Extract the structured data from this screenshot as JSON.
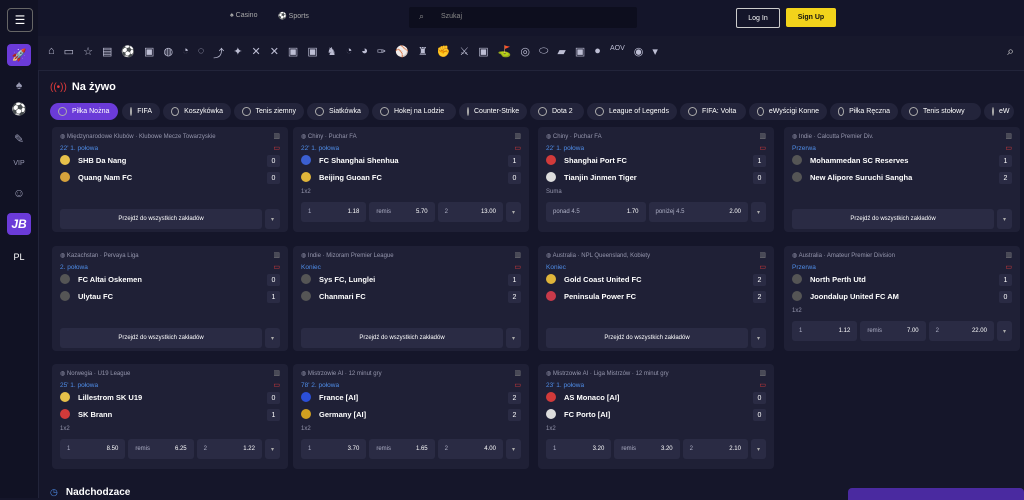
{
  "nav": {
    "casino": "Casino",
    "sports": "Sports",
    "search_placeholder": "Szukaj",
    "login": "Log In",
    "signup": "Sign Up",
    "lang": "PL",
    "jb": "JB"
  },
  "live_title": "Na żywo",
  "upcoming_title": "Nadchodzace",
  "sports": [
    "Piłka Nożna",
    "FIFA",
    "Koszykówka",
    "Tenis ziemny",
    "Siatkówka",
    "Hokej na Lodzie",
    "Counter-Strike",
    "Dota 2",
    "League of Legends",
    "FIFA: Volta",
    "eWyścigi Konne",
    "Piłka Ręczna",
    "Tenis stołowy",
    "eW"
  ],
  "all_bets": "Przejdź do wszystkich zakładów",
  "matches": [
    {
      "comp": "Międzynarodowe Klubów · Klubowe Mecze Towarzyskie",
      "status": "22' 1. połowa",
      "t1": "SHB Da Nang",
      "s1": "0",
      "t2": "Quang Nam FC",
      "s2": "0",
      "c1": "#e7c14a",
      "c2": "#d6a23c"
    },
    {
      "comp": "Chiny · Puchar FA",
      "status": "22' 1. połowa",
      "t1": "FC Shanghai Shenhua",
      "s1": "1",
      "t2": "Beijing Guoan FC",
      "s2": "0",
      "c1": "#3b5fd0",
      "c2": "#e0b53a",
      "market": "1x2",
      "odds": [
        [
          "1",
          "1.18"
        ],
        [
          "remis",
          "5.70"
        ],
        [
          "2",
          "13.00"
        ]
      ]
    },
    {
      "comp": "Chiny · Puchar FA",
      "status": "22' 1. połowa",
      "t1": "Shanghai Port FC",
      "s1": "1",
      "t2": "Tianjin Jinmen Tiger",
      "s2": "0",
      "c1": "#d23a3a",
      "c2": "#dddddd",
      "market": "Suma",
      "odds": [
        [
          "ponad 4.5",
          "1.70"
        ],
        [
          "poniżej 4.5",
          "2.00"
        ]
      ]
    },
    {
      "comp": "Indie · Calcutta Premier Div.",
      "status": "Przerwa",
      "t1": "Mohammedan SC Reserves",
      "s1": "1",
      "t2": "New Alipore Suruchi Sangha",
      "s2": "2",
      "c1": "#555",
      "c2": "#555"
    },
    {
      "comp": "Kazachstan · Pervaya Liga",
      "status": "2. połowa",
      "t1": "FC Altai Oskemen",
      "s1": "0",
      "t2": "Ulytau FC",
      "s2": "1",
      "c1": "#555",
      "c2": "#555"
    },
    {
      "comp": "Indie · Mizoram Premier League",
      "status": "Koniec",
      "t1": "Sys FC, Lunglei",
      "s1": "1",
      "t2": "Chanmari FC",
      "s2": "2",
      "c1": "#555",
      "c2": "#555"
    },
    {
      "comp": "Australia · NPL Queensland, Kobiety",
      "status": "Koniec",
      "t1": "Gold Coast United FC",
      "s1": "2",
      "t2": "Peninsula Power FC",
      "s2": "2",
      "c1": "#e0b53a",
      "c2": "#c93a4a"
    },
    {
      "comp": "Australia · Amateur Premier Division",
      "status": "Przerwa",
      "t1": "North Perth Utd",
      "s1": "1",
      "t2": "Joondalup United FC AM",
      "s2": "0",
      "c1": "#555",
      "c2": "#555",
      "market": "1x2",
      "odds": [
        [
          "1",
          "1.12"
        ],
        [
          "remis",
          "7.00"
        ],
        [
          "2",
          "22.00"
        ]
      ]
    },
    {
      "comp": "Norwegia · U19 League",
      "status": "25' 1. połowa",
      "t1": "Lillestrom SK U19",
      "s1": "0",
      "t2": "SK Brann",
      "s2": "1",
      "c1": "#e7c14a",
      "c2": "#d23a3a",
      "market": "1x2",
      "odds": [
        [
          "1",
          "8.50"
        ],
        [
          "remis",
          "6.25"
        ],
        [
          "2",
          "1.22"
        ]
      ]
    },
    {
      "comp": "Mistrzowie AI · 12 minut gry",
      "status": "78' 2. połowa",
      "t1": "France [AI]",
      "s1": "2",
      "t2": "Germany [AI]",
      "s2": "2",
      "c1": "#2b4fd8",
      "c2": "#d1a020",
      "market": "1x2",
      "odds": [
        [
          "1",
          "3.70"
        ],
        [
          "remis",
          "1.65"
        ],
        [
          "2",
          "4.00"
        ]
      ]
    },
    {
      "comp": "Mistrzowie AI · Liga Mistrzów · 12 minut gry",
      "status": "23' 1. połowa",
      "t1": "AS Monaco [AI]",
      "s1": "0",
      "t2": "FC Porto [AI]",
      "s2": "0",
      "c1": "#d23a3a",
      "c2": "#dddddd",
      "market": "1x2",
      "odds": [
        [
          "1",
          "3.20"
        ],
        [
          "remis",
          "3.20"
        ],
        [
          "2",
          "2.10"
        ]
      ]
    }
  ]
}
